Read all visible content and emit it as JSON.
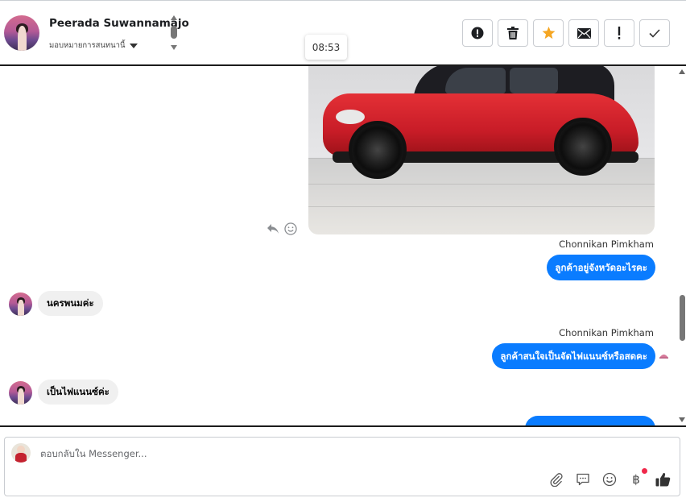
{
  "header": {
    "contact_name": "Peerada Suwannamajo",
    "assign_label": "มอบหมายการสนทนานี้",
    "tooltip_time": "08:53",
    "actions": [
      {
        "name": "report-spam-button",
        "icon": "exclamation-circle-icon"
      },
      {
        "name": "delete-button",
        "icon": "trash-icon"
      },
      {
        "name": "star-button",
        "icon": "star-icon",
        "color": "#f5a623"
      },
      {
        "name": "mark-unread-button",
        "icon": "envelope-icon"
      },
      {
        "name": "mark-important-button",
        "icon": "exclamation-icon"
      },
      {
        "name": "done-button",
        "icon": "check-icon"
      }
    ]
  },
  "messages": [
    {
      "type": "image",
      "from": "out",
      "alt_icon": "car-photo"
    },
    {
      "type": "sender",
      "text": "Chonnikan Pimkham"
    },
    {
      "type": "out",
      "text": "ลูกค้าอยู่จังหวัดอะไรคะ"
    },
    {
      "type": "in",
      "text": "นครพนมค่ะ"
    },
    {
      "type": "sender",
      "text": "Chonnikan Pimkham"
    },
    {
      "type": "out",
      "text": "ลูกค้าสนใจเป็นจัดไฟแนนซ์หรือสดคะ"
    },
    {
      "type": "in",
      "text": "เป็นไฟแนนซ์ค่ะ"
    }
  ],
  "composer": {
    "placeholder": "ตอบกลับใน Messenger...",
    "icons": [
      "paperclip-icon",
      "saved-reply-icon",
      "emoji-icon",
      "baht-icon",
      "thumbs-up-icon"
    ],
    "baht_symbol": "฿"
  },
  "colors": {
    "accent": "#0a7cff",
    "incoming_bubble": "#f0f0f0",
    "star": "#f5a623",
    "notification_dot": "#f0284a"
  }
}
